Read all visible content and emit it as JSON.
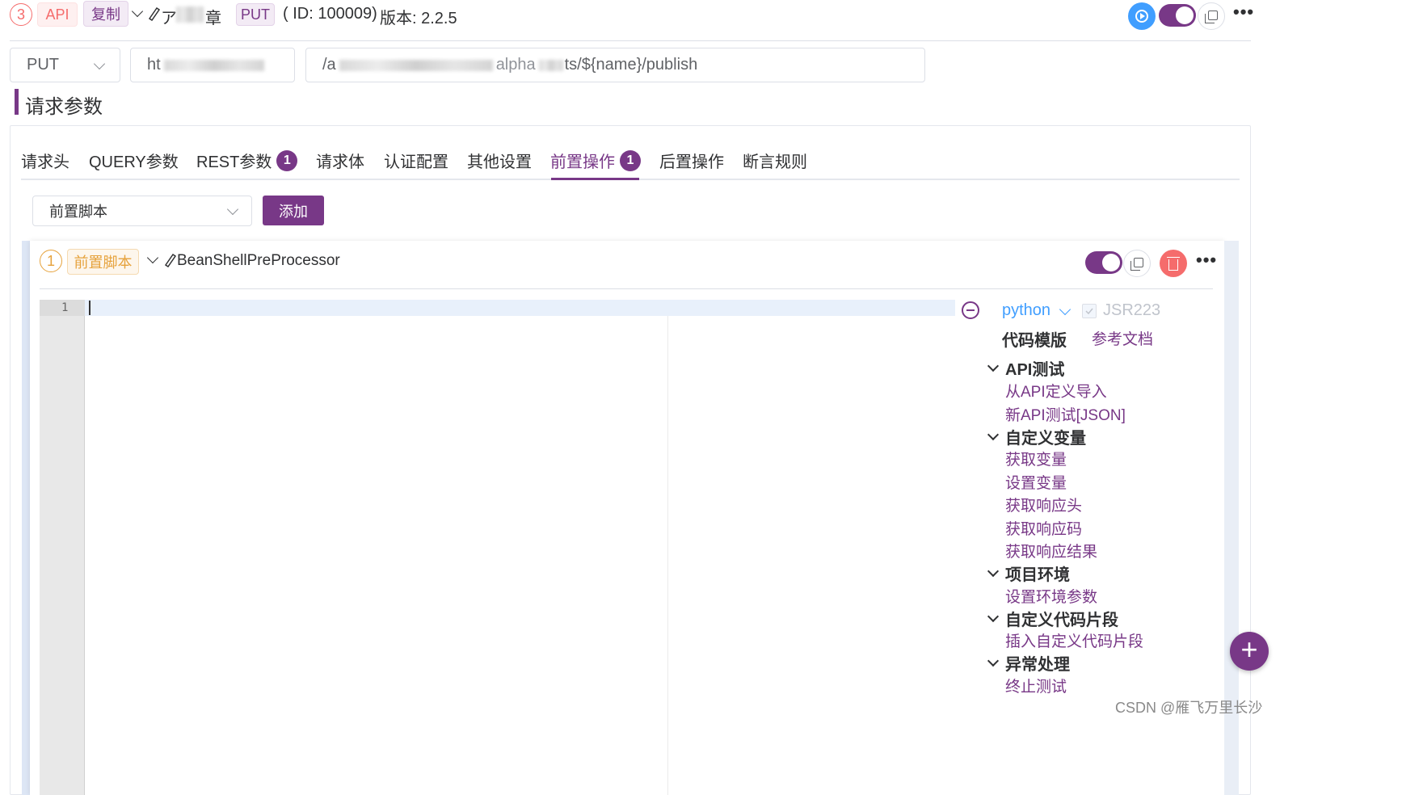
{
  "header": {
    "index": "3",
    "api_tag": "API",
    "copy_tag": "复制",
    "name_prefix": "ア",
    "name_suffix": "章",
    "method_tag": "PUT",
    "id_text": "( ID: 100009)",
    "version_text": "版本: 2.2.5"
  },
  "request": {
    "method": "PUT",
    "host": "ht",
    "path_start": "/a",
    "path_mid": "alpha",
    "path_end": "ts/${name}/publish"
  },
  "section_title": "请求参数",
  "tabs": [
    {
      "label": "请求头"
    },
    {
      "label": "QUERY参数"
    },
    {
      "label": "REST参数",
      "badge": "1"
    },
    {
      "label": "请求体"
    },
    {
      "label": "认证配置"
    },
    {
      "label": "其他设置"
    },
    {
      "label": "前置操作",
      "badge": "1"
    },
    {
      "label": "后置操作"
    },
    {
      "label": "断言规则"
    }
  ],
  "active_tab": "前置操作",
  "pre_select": {
    "value": "前置脚本"
  },
  "add_button": "添加",
  "processor": {
    "index": "1",
    "tag": "前置脚本",
    "name": "BeanShellPreProcessor",
    "enabled": true
  },
  "editor": {
    "line_numbers": [
      "1"
    ]
  },
  "script_panel": {
    "language": "python",
    "jsr_label": "JSR223",
    "template_title": "代码模版",
    "doc_link": "参考文档",
    "groups": [
      {
        "title": "API测试",
        "items": [
          "从API定义导入",
          "新API测试[JSON]"
        ]
      },
      {
        "title": "自定义变量",
        "items": [
          "获取变量",
          "设置变量",
          "获取响应头",
          "获取响应码",
          "获取响应结果"
        ]
      },
      {
        "title": "项目环境",
        "items": [
          "设置环境参数"
        ]
      },
      {
        "title": "自定义代码片段",
        "items": [
          "插入自定义代码片段"
        ]
      },
      {
        "title": "异常处理",
        "items": [
          "终止测试"
        ]
      }
    ]
  },
  "fab_symbol": "+",
  "watermark": "CSDN @雁飞万里长沙",
  "colors": {
    "accent": "#783887",
    "danger": "#f56c6c",
    "info": "#409eff",
    "warning": "#e6a23c"
  }
}
